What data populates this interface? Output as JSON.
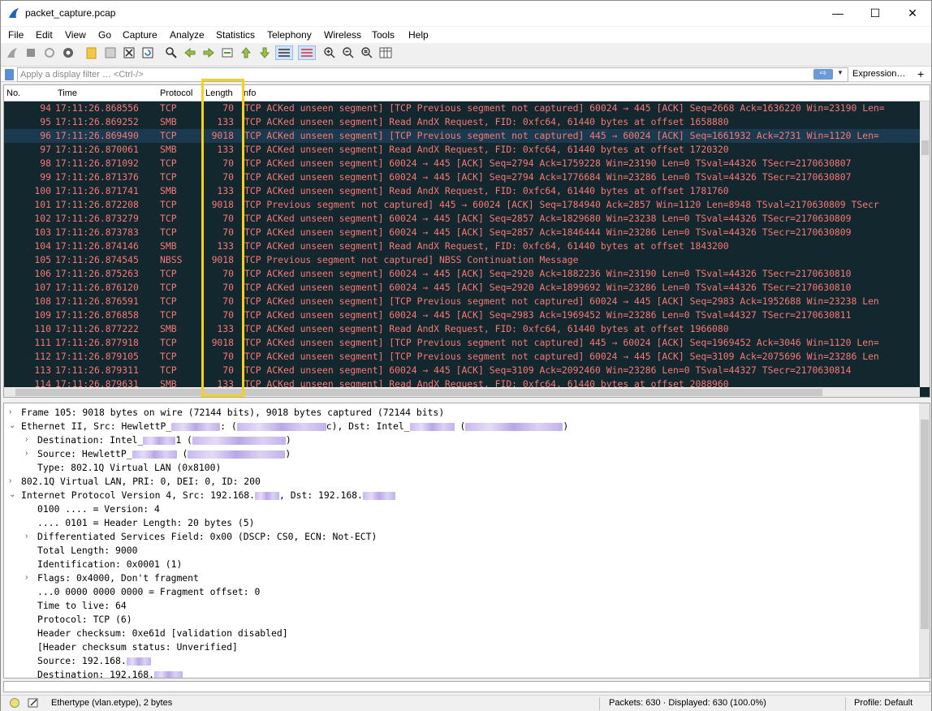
{
  "window": {
    "title": "packet_capture.pcap",
    "min": "—",
    "max": "☐",
    "close": "✕"
  },
  "menu": [
    "File",
    "Edit",
    "View",
    "Go",
    "Capture",
    "Analyze",
    "Statistics",
    "Telephony",
    "Wireless",
    "Tools",
    "Help"
  ],
  "filter": {
    "placeholder": "Apply a display filter … <Ctrl-/>",
    "expression_label": "Expression…",
    "plus": "+",
    "arrow": "⇨",
    "dropdown": "▼"
  },
  "columns": {
    "no": "No.",
    "time": "Time",
    "protocol": "Protocol",
    "length": "Length",
    "info": "Info"
  },
  "packets": [
    {
      "no": "94",
      "time": "17:11:26.868556",
      "proto": "TCP",
      "len": "70",
      "info": "TCP ACKed unseen segment] [TCP Previous segment not captured] 60024 → 445 [ACK] Seq=2668 Ack=1636220 Win=23190 Len="
    },
    {
      "no": "95",
      "time": "17:11:26.869252",
      "proto": "SMB",
      "len": "133",
      "info": "TCP ACKed unseen segment] Read AndX Request, FID: 0xfc64, 61440 bytes at offset 1658880"
    },
    {
      "no": "96",
      "time": "17:11:26.869490",
      "proto": "TCP",
      "len": "9018",
      "info": "TCP ACKed unseen segment] [TCP Previous segment not captured] 445 → 60024 [ACK] Seq=1661932 Ack=2731 Win=1120 Len="
    },
    {
      "no": "97",
      "time": "17:11:26.870061",
      "proto": "SMB",
      "len": "133",
      "info": "TCP ACKed unseen segment] Read AndX Request, FID: 0xfc64, 61440 bytes at offset 1720320"
    },
    {
      "no": "98",
      "time": "17:11:26.871092",
      "proto": "TCP",
      "len": "70",
      "info": "TCP ACKed unseen segment] 60024 → 445 [ACK] Seq=2794 Ack=1759228 Win=23190 Len=0 TSval=44326 TSecr=2170630807"
    },
    {
      "no": "99",
      "time": "17:11:26.871376",
      "proto": "TCP",
      "len": "70",
      "info": "TCP ACKed unseen segment] 60024 → 445 [ACK] Seq=2794 Ack=1776684 Win=23286 Len=0 TSval=44326 TSecr=2170630807"
    },
    {
      "no": "100",
      "time": "17:11:26.871741",
      "proto": "SMB",
      "len": "133",
      "info": "TCP ACKed unseen segment] Read AndX Request, FID: 0xfc64, 61440 bytes at offset 1781760"
    },
    {
      "no": "101",
      "time": "17:11:26.872208",
      "proto": "TCP",
      "len": "9018",
      "info": "TCP Previous segment not captured] 445 → 60024 [ACK] Seq=1784940 Ack=2857 Win=1120 Len=8948 TSval=2170630809 TSecr"
    },
    {
      "no": "102",
      "time": "17:11:26.873279",
      "proto": "TCP",
      "len": "70",
      "info": "TCP ACKed unseen segment] 60024 → 445 [ACK] Seq=2857 Ack=1829680 Win=23238 Len=0 TSval=44326 TSecr=2170630809"
    },
    {
      "no": "103",
      "time": "17:11:26.873783",
      "proto": "TCP",
      "len": "70",
      "info": "TCP ACKed unseen segment] 60024 → 445 [ACK] Seq=2857 Ack=1846444 Win=23286 Len=0 TSval=44326 TSecr=2170630809"
    },
    {
      "no": "104",
      "time": "17:11:26.874146",
      "proto": "SMB",
      "len": "133",
      "info": "TCP ACKed unseen segment] Read AndX Request, FID: 0xfc64, 61440 bytes at offset 1843200"
    },
    {
      "no": "105",
      "time": "17:11:26.874545",
      "proto": "NBSS",
      "len": "9018",
      "info": "TCP Previous segment not captured] NBSS Continuation Message"
    },
    {
      "no": "106",
      "time": "17:11:26.875263",
      "proto": "TCP",
      "len": "70",
      "info": "TCP ACKed unseen segment] 60024 → 445 [ACK] Seq=2920 Ack=1882236 Win=23190 Len=0 TSval=44326 TSecr=2170630810"
    },
    {
      "no": "107",
      "time": "17:11:26.876120",
      "proto": "TCP",
      "len": "70",
      "info": "TCP ACKed unseen segment] 60024 → 445 [ACK] Seq=2920 Ack=1899692 Win=23286 Len=0 TSval=44326 TSecr=2170630810"
    },
    {
      "no": "108",
      "time": "17:11:26.876591",
      "proto": "TCP",
      "len": "70",
      "info": "TCP ACKed unseen segment] [TCP Previous segment not captured] 60024 → 445 [ACK] Seq=2983 Ack=1952688 Win=23238 Len"
    },
    {
      "no": "109",
      "time": "17:11:26.876858",
      "proto": "TCP",
      "len": "70",
      "info": "TCP ACKed unseen segment] 60024 → 445 [ACK] Seq=2983 Ack=1969452 Win=23286 Len=0 TSval=44327 TSecr=2170630811"
    },
    {
      "no": "110",
      "time": "17:11:26.877222",
      "proto": "SMB",
      "len": "133",
      "info": "TCP ACKed unseen segment] Read AndX Request, FID: 0xfc64, 61440 bytes at offset 1966080"
    },
    {
      "no": "111",
      "time": "17:11:26.877918",
      "proto": "TCP",
      "len": "9018",
      "info": "TCP ACKed unseen segment] [TCP Previous segment not captured] 445 → 60024 [ACK] Seq=1969452 Ack=3046 Win=1120 Len="
    },
    {
      "no": "112",
      "time": "17:11:26.879105",
      "proto": "TCP",
      "len": "70",
      "info": "TCP ACKed unseen segment] [TCP Previous segment not captured] 60024 → 445 [ACK] Seq=3109 Ack=2075696 Win=23286 Len"
    },
    {
      "no": "113",
      "time": "17:11:26.879311",
      "proto": "TCP",
      "len": "70",
      "info": "TCP ACKed unseen segment] 60024 → 445 [ACK] Seq=3109 Ack=2092460 Win=23286 Len=0 TSval=44327 TSecr=2170630814"
    },
    {
      "no": "114",
      "time": "17:11:26.879631",
      "proto": "SMB",
      "len": "133",
      "info": "TCP ACKed unseen segment] Read AndX Request, FID: 0xfc64, 61440 bytes at offset 2088960"
    }
  ],
  "selected_packet": "96",
  "details": [
    {
      "caret": ">",
      "indent": 0,
      "text": "Frame 105: 9018 bytes on wire (72144 bits), 9018 bytes captured (72144 bits)"
    },
    {
      "caret": "v",
      "indent": 0,
      "text": "Ethernet II, Src: HewlettP_",
      "blur": 60,
      "text2": ": (",
      "blur2": 110,
      "text3": "c), Dst: Intel_",
      "blur3": 55,
      "text4": " (",
      "blur4": 120,
      "text5": ")"
    },
    {
      "caret": ">",
      "indent": 1,
      "text": "Destination: Intel_",
      "blur": 40,
      "text2": "1 (",
      "blur2": 115,
      "text3": ")"
    },
    {
      "caret": ">",
      "indent": 1,
      "text": "Source: HewlettP_",
      "blur": 55,
      "text2": " (",
      "blur2": 120,
      "text3": ")"
    },
    {
      "caret": "",
      "indent": 1,
      "text": "Type: 802.1Q Virtual LAN (0x8100)"
    },
    {
      "caret": ">",
      "indent": 0,
      "text": "802.1Q Virtual LAN, PRI: 0, DEI: 0, ID: 200"
    },
    {
      "caret": "v",
      "indent": 0,
      "text": "Internet Protocol Version 4, Src: 192.168.",
      "blur": 30,
      "text2": ", Dst: 192.168.",
      "blur2": 40
    },
    {
      "caret": "",
      "indent": 1,
      "text": "0100 .... = Version: 4"
    },
    {
      "caret": "",
      "indent": 1,
      "text": ".... 0101 = Header Length: 20 bytes (5)"
    },
    {
      "caret": ">",
      "indent": 1,
      "text": "Differentiated Services Field: 0x00 (DSCP: CS0, ECN: Not-ECT)"
    },
    {
      "caret": "",
      "indent": 1,
      "text": "Total Length: 9000"
    },
    {
      "caret": "",
      "indent": 1,
      "text": "Identification: 0x0001 (1)"
    },
    {
      "caret": ">",
      "indent": 1,
      "text": "Flags: 0x4000, Don't fragment"
    },
    {
      "caret": "",
      "indent": 1,
      "text": "...0 0000 0000 0000 = Fragment offset: 0"
    },
    {
      "caret": "",
      "indent": 1,
      "text": "Time to live: 64"
    },
    {
      "caret": "",
      "indent": 1,
      "text": "Protocol: TCP (6)"
    },
    {
      "caret": "",
      "indent": 1,
      "text": "Header checksum: 0xe61d [validation disabled]"
    },
    {
      "caret": "",
      "indent": 1,
      "text": "[Header checksum status: Unverified]"
    },
    {
      "caret": "",
      "indent": 1,
      "text": "Source: 192.168.",
      "blur": 30
    },
    {
      "caret": "",
      "indent": 1,
      "text": "Destination: 192.168.",
      "blur": 35
    }
  ],
  "status": {
    "field": "Ethertype (vlan.etype), 2 bytes",
    "packets": "Packets: 630 · Displayed: 630 (100.0%)",
    "profile": "Profile: Default"
  },
  "colors": {
    "list_bg": "#12272e",
    "list_fg": "#f87876",
    "highlight": "#f4d21c"
  }
}
